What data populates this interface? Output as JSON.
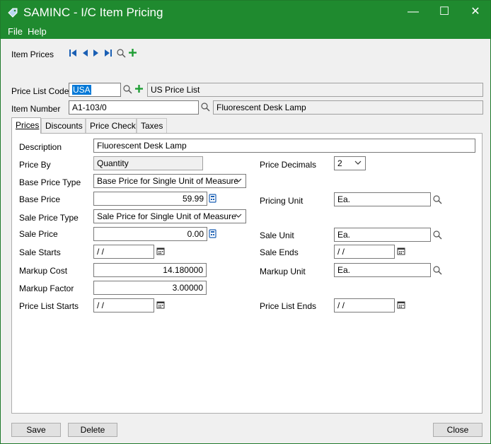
{
  "window": {
    "title": "SAMINC - I/C Item Pricing"
  },
  "menu": {
    "file": "File",
    "help": "Help"
  },
  "toolbar": {
    "label": "Item Prices"
  },
  "header": {
    "price_list_code_label": "Price List Code",
    "price_list_code": "USA",
    "price_list_desc": "US Price List",
    "item_number_label": "Item Number",
    "item_number": "A1-103/0",
    "item_desc": "Fluorescent Desk Lamp"
  },
  "tabs": [
    "Prices",
    "Discounts",
    "Price Check",
    "Taxes"
  ],
  "form": {
    "description_label": "Description",
    "description": "Fluorescent Desk Lamp",
    "price_by_label": "Price By",
    "price_by": "Quantity",
    "price_decimals_label": "Price Decimals",
    "price_decimals": "2",
    "base_price_type_label": "Base Price Type",
    "base_price_type": "Base Price for Single Unit of Measure",
    "base_price_label": "Base Price",
    "base_price": "59.99",
    "pricing_unit_label": "Pricing Unit",
    "pricing_unit": "Ea.",
    "sale_price_type_label": "Sale Price Type",
    "sale_price_type": "Sale Price for Single Unit of Measure",
    "sale_price_label": "Sale Price",
    "sale_price": "0.00",
    "sale_unit_label": "Sale Unit",
    "sale_unit": "Ea.",
    "sale_starts_label": "Sale Starts",
    "sale_starts": " /  /",
    "sale_ends_label": "Sale Ends",
    "sale_ends": " /  /",
    "markup_cost_label": "Markup Cost",
    "markup_cost": "14.180000",
    "markup_unit_label": "Markup Unit",
    "markup_unit": "Ea.",
    "markup_factor_label": "Markup Factor",
    "markup_factor": "3.00000",
    "price_list_starts_label": "Price List Starts",
    "price_list_starts": " /  /",
    "price_list_ends_label": "Price List Ends",
    "price_list_ends": " /  /"
  },
  "buttons": {
    "save": "Save",
    "delete": "Delete",
    "close": "Close"
  },
  "colors": {
    "titlebar": "#1f8a2f",
    "accent": "#0078d7",
    "add_green": "#1e9e34"
  }
}
